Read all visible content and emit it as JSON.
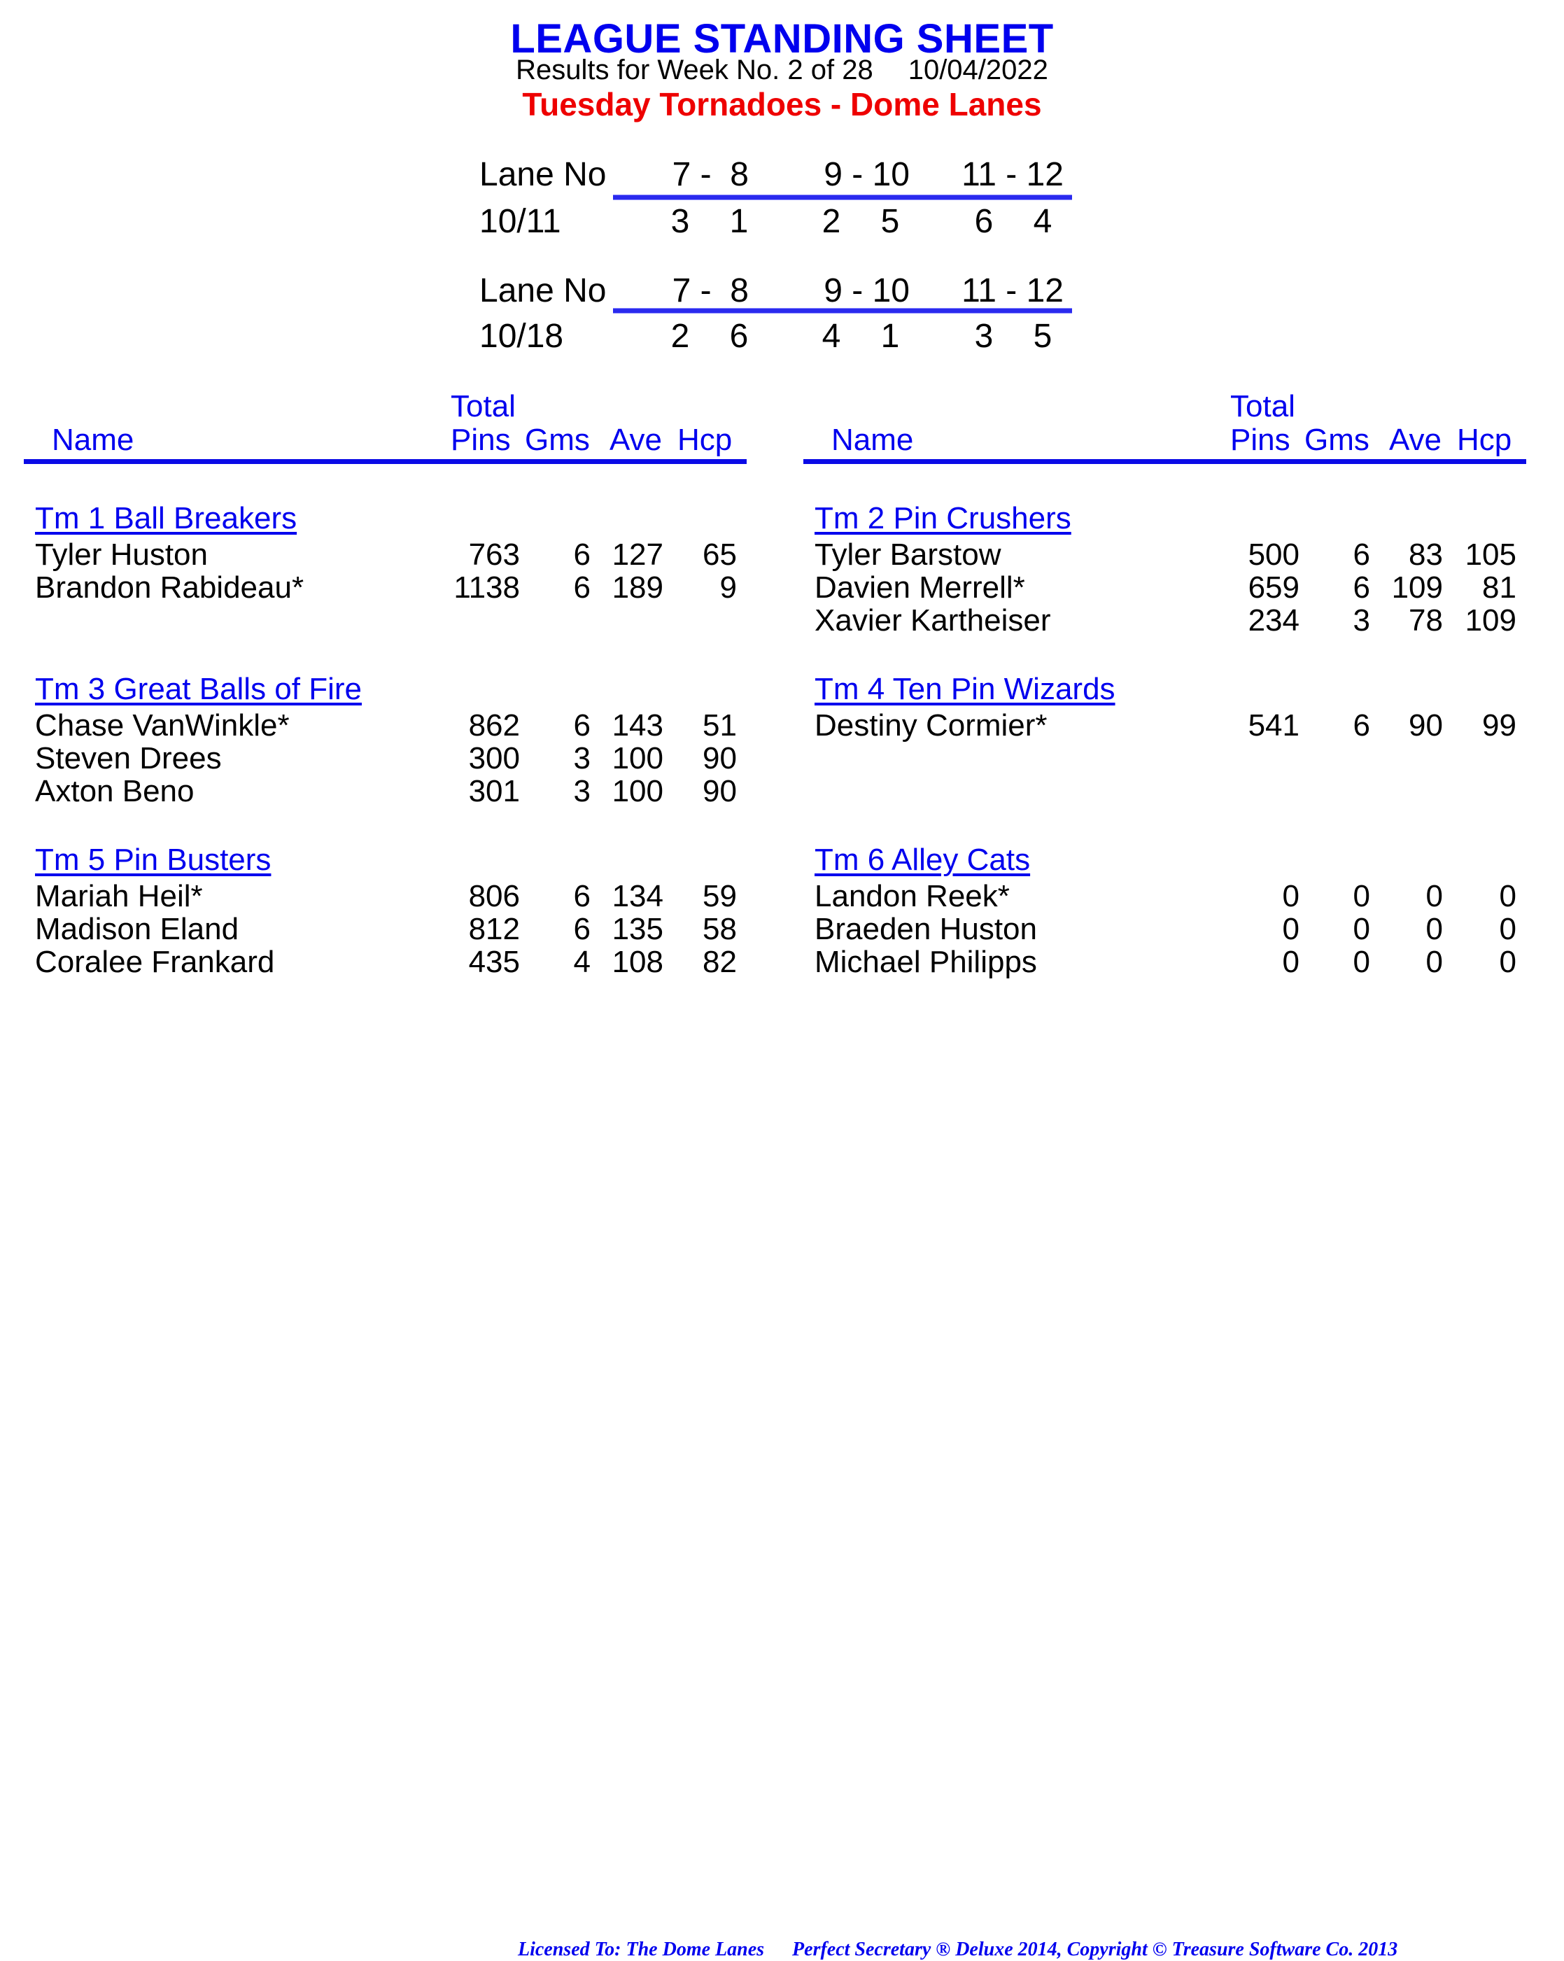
{
  "header": {
    "title": "LEAGUE STANDING SHEET",
    "results_text": "Results for Week No. 2 of 28",
    "date": "10/04/2022",
    "league_name": "Tuesday Tornadoes - Dome Lanes"
  },
  "lane_schedule": [
    {
      "label": "Lane No",
      "lanes": [
        "7 -  8",
        "9 - 10",
        "11 - 12"
      ],
      "date": "10/11",
      "matchups": [
        [
          "3",
          "1"
        ],
        [
          "2",
          "5"
        ],
        [
          "6",
          "4"
        ]
      ]
    },
    {
      "label": "Lane No",
      "lanes": [
        "7 -  8",
        "9 - 10",
        "11 - 12"
      ],
      "date": "10/18",
      "matchups": [
        [
          "2",
          "6"
        ],
        [
          "4",
          "1"
        ],
        [
          "3",
          "5"
        ]
      ]
    }
  ],
  "columns": {
    "name": "Name",
    "total": "Total",
    "pins": "Pins",
    "gms": "Gms",
    "ave": "Ave",
    "hcp": "Hcp"
  },
  "teams": [
    {
      "name": "Tm 1 Ball Breakers",
      "players": [
        {
          "name": "Tyler Huston",
          "pins": "763",
          "gms": "6",
          "ave": "127",
          "hcp": "65"
        },
        {
          "name": "Brandon Rabideau*",
          "pins": "1138",
          "gms": "6",
          "ave": "189",
          "hcp": "9"
        }
      ]
    },
    {
      "name": "Tm 2 Pin Crushers",
      "players": [
        {
          "name": "Tyler Barstow",
          "pins": "500",
          "gms": "6",
          "ave": "83",
          "hcp": "105"
        },
        {
          "name": "Davien Merrell*",
          "pins": "659",
          "gms": "6",
          "ave": "109",
          "hcp": "81"
        },
        {
          "name": "Xavier Kartheiser",
          "pins": "234",
          "gms": "3",
          "ave": "78",
          "hcp": "109"
        }
      ]
    },
    {
      "name": "Tm 3 Great Balls of Fire",
      "players": [
        {
          "name": "Chase VanWinkle*",
          "pins": "862",
          "gms": "6",
          "ave": "143",
          "hcp": "51"
        },
        {
          "name": "Steven Drees",
          "pins": "300",
          "gms": "3",
          "ave": "100",
          "hcp": "90"
        },
        {
          "name": "Axton Beno",
          "pins": "301",
          "gms": "3",
          "ave": "100",
          "hcp": "90"
        }
      ]
    },
    {
      "name": "Tm 4 Ten Pin Wizards",
      "players": [
        {
          "name": "Destiny Cormier*",
          "pins": "541",
          "gms": "6",
          "ave": "90",
          "hcp": "99"
        }
      ]
    },
    {
      "name": "Tm 5 Pin Busters",
      "players": [
        {
          "name": "Mariah Heil*",
          "pins": "806",
          "gms": "6",
          "ave": "134",
          "hcp": "59"
        },
        {
          "name": "Madison Eland",
          "pins": "812",
          "gms": "6",
          "ave": "135",
          "hcp": "58"
        },
        {
          "name": "Coralee Frankard",
          "pins": "435",
          "gms": "4",
          "ave": "108",
          "hcp": "82"
        }
      ]
    },
    {
      "name": "Tm 6 Alley Cats",
      "players": [
        {
          "name": "Landon Reek*",
          "pins": "0",
          "gms": "0",
          "ave": "0",
          "hcp": "0"
        },
        {
          "name": "Braeden Huston",
          "pins": "0",
          "gms": "0",
          "ave": "0",
          "hcp": "0"
        },
        {
          "name": "Michael Philipps",
          "pins": "0",
          "gms": "0",
          "ave": "0",
          "hcp": "0"
        }
      ]
    }
  ],
  "footer": {
    "license": "Licensed To: The Dome Lanes",
    "copyright": "Perfect Secretary ® Deluxe  2014, Copyright © Treasure Software Co. 2013"
  },
  "colors": {
    "title": "#0000ee",
    "league_name": "#ee0000",
    "header_blue": "#0000ee"
  }
}
